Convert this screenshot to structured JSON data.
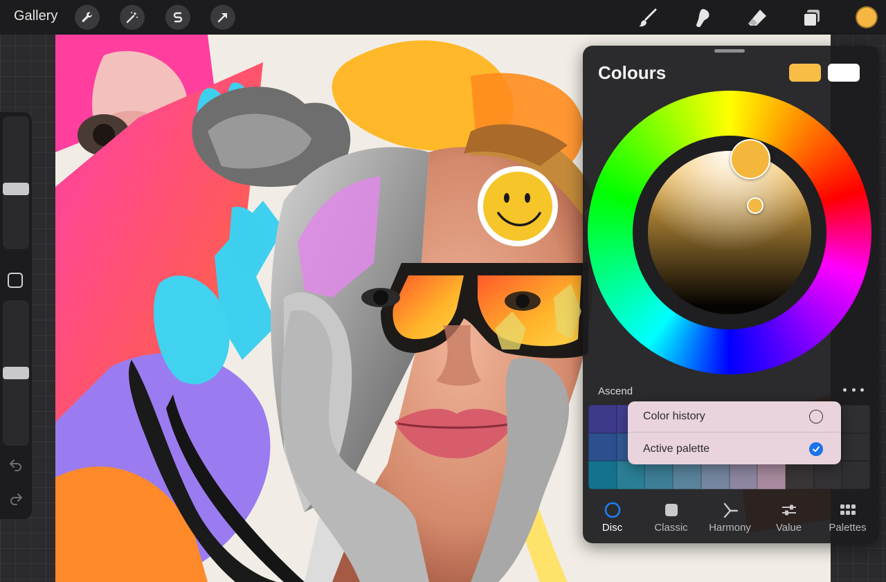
{
  "toolbar": {
    "gallery_label": "Gallery",
    "left_tools": [
      "wrench-icon",
      "magic-wand-icon",
      "selection-icon",
      "transform-arrow-icon"
    ],
    "right_tools": [
      "brush-icon",
      "smudge-icon",
      "eraser-icon",
      "layers-icon"
    ],
    "current_colour": "#f5b642"
  },
  "sidebar": {
    "size_slider_level": 0.45,
    "opacity_slider_level": 0.5
  },
  "colour_panel": {
    "title": "Colours",
    "primary_colour": "#f7bd45",
    "secondary_colour": "#ffffff",
    "hue_handle_colour": "#f5b73b",
    "saturation_handle_colour": "#f2b843",
    "palette_name": "Ascend",
    "palette_colours": [
      [
        "#3e3a8a",
        "#423f90",
        "#4a4696",
        "#524d9b",
        "#5a549f",
        "#6c5fa6",
        "#7b62a8",
        "#2f2f33",
        "#2f2f33",
        "#2f2f33"
      ],
      [
        "#2d4f8e",
        "#345895",
        "#3b609a",
        "#4a66a0",
        "#5a6aa3",
        "#7570a8",
        "#8b73a8",
        "#2f2f33",
        "#2f2f33",
        "#2f2f33"
      ],
      [
        "#14728e",
        "#2a7f96",
        "#3e7f98",
        "#59849c",
        "#7587a0",
        "#8d87a2",
        "#a98b9f",
        "#3a3536",
        "#343234",
        "#2f2f33"
      ]
    ],
    "palette_source_menu": {
      "items": [
        {
          "label": "Color history",
          "selected": false
        },
        {
          "label": "Active palette",
          "selected": true
        }
      ]
    },
    "tabs": [
      {
        "label": "Disc",
        "icon": "disc-icon",
        "active": true
      },
      {
        "label": "Classic",
        "icon": "square-icon",
        "active": false
      },
      {
        "label": "Harmony",
        "icon": "harmony-icon",
        "active": false
      },
      {
        "label": "Value",
        "icon": "sliders-icon",
        "active": false
      },
      {
        "label": "Palettes",
        "icon": "grid-icon",
        "active": false
      }
    ]
  }
}
